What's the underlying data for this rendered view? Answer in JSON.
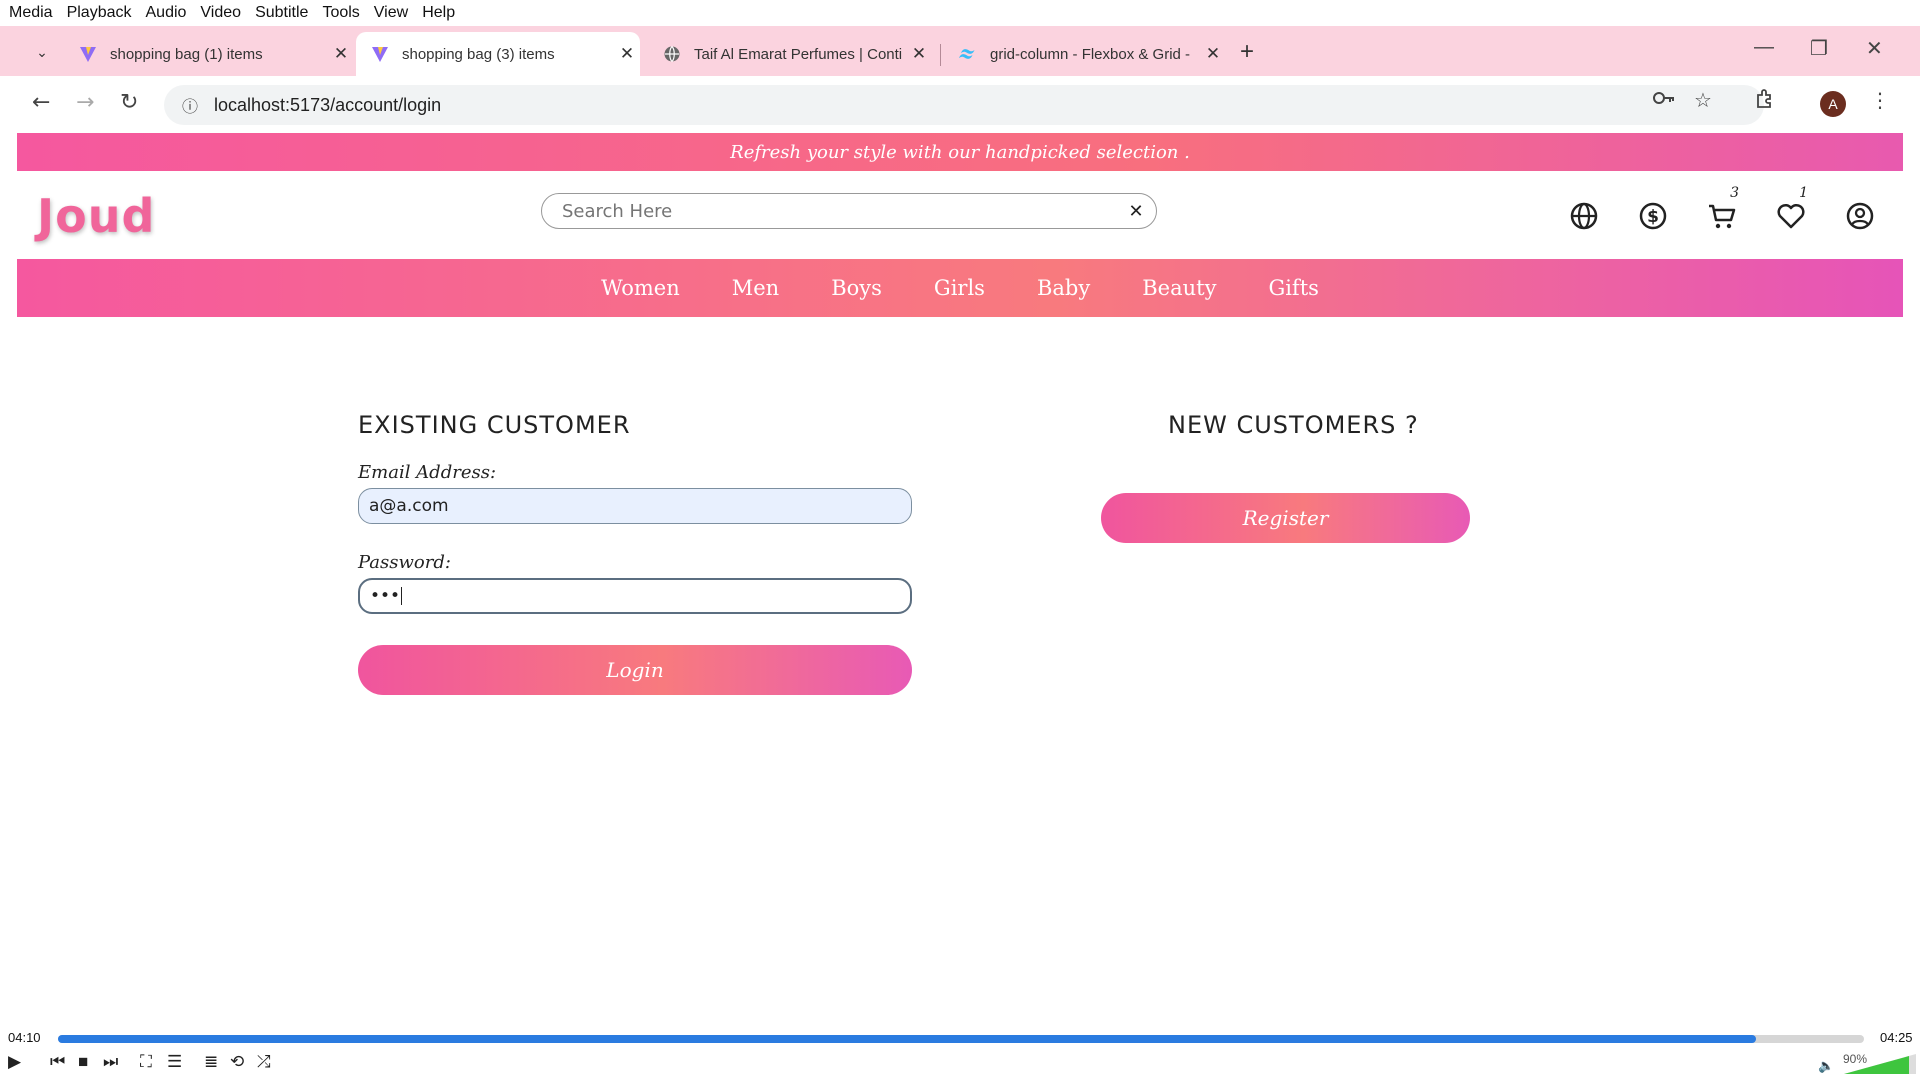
{
  "vlc": {
    "menu": [
      "Media",
      "Playback",
      "Audio",
      "Video",
      "Subtitle",
      "Tools",
      "View",
      "Help"
    ],
    "elapsed": "04:10",
    "total": "04:25",
    "progress": 0.94,
    "volume": "90%"
  },
  "browser": {
    "tabs": [
      {
        "title": "shopping bag (1) items"
      },
      {
        "title": "shopping bag (3) items"
      },
      {
        "title": "Taif Al Emarat Perfumes | Conti"
      },
      {
        "title": "grid-column - Flexbox & Grid -"
      }
    ],
    "url": "localhost:5173/account/login",
    "profile_initial": "A"
  },
  "site": {
    "promo": "Refresh your style with our handpicked selection .",
    "logo": "Joud",
    "search_placeholder": "Search Here",
    "cart_count": "3",
    "wishlist_count": "1",
    "categories": [
      "Women",
      "Men",
      "Boys",
      "Girls",
      "Baby",
      "Beauty",
      "Gifts"
    ]
  },
  "login": {
    "existing_title": "EXISTING CUSTOMER",
    "email_label": "Email Address:",
    "email_value": "a@a.com",
    "password_label": "Password:",
    "password_value": "•••",
    "login_button": "Login",
    "new_title": "NEW CUSTOMERS ?",
    "register_button": "Register"
  },
  "colors": {
    "brand_pink": "#f0659a",
    "gradient_start": "#f5589f",
    "gradient_end": "#e654b8",
    "tabstrip": "#fbd3df",
    "seek_fill": "#2a7be0"
  }
}
